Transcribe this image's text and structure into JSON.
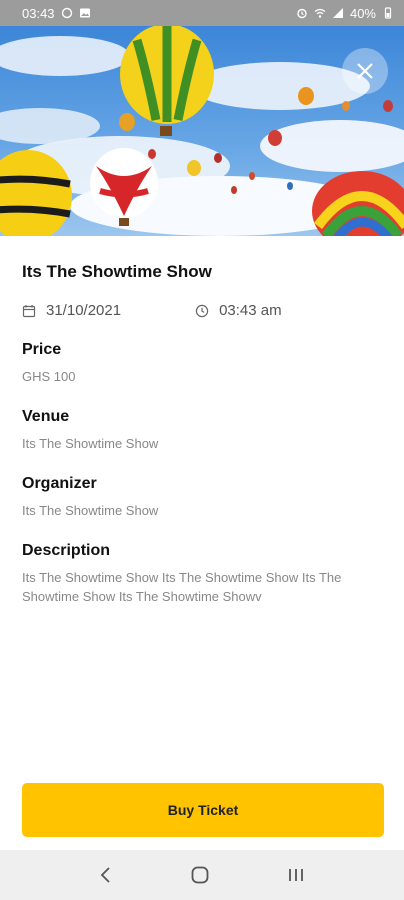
{
  "status_bar": {
    "time": "03:43",
    "battery": "40%",
    "icons": [
      "whatsapp-icon",
      "gallery-icon",
      "alarm-icon",
      "wifi-icon",
      "signal-icon",
      "battery-icon"
    ]
  },
  "hero": {
    "image": "hot-air-balloons-photo",
    "close_icon": "close-icon"
  },
  "event": {
    "title": "Its The Showtime Show",
    "date": "31/10/2021",
    "time": "03:43 am",
    "price_label": "Price",
    "price_value": "GHS 100",
    "venue_label": "Venue",
    "venue_value": "Its The Showtime Show",
    "organizer_label": "Organizer",
    "organizer_value": "Its The Showtime Show",
    "description_label": "Description",
    "description_value": "Its The Showtime Show Its The Showtime Show Its The Showtime Show Its The Showtime Showv"
  },
  "actions": {
    "buy_label": "Buy Ticket",
    "accent": "#ffc300"
  },
  "nav": {
    "items": [
      "back-icon",
      "home-icon",
      "recents-icon"
    ]
  }
}
